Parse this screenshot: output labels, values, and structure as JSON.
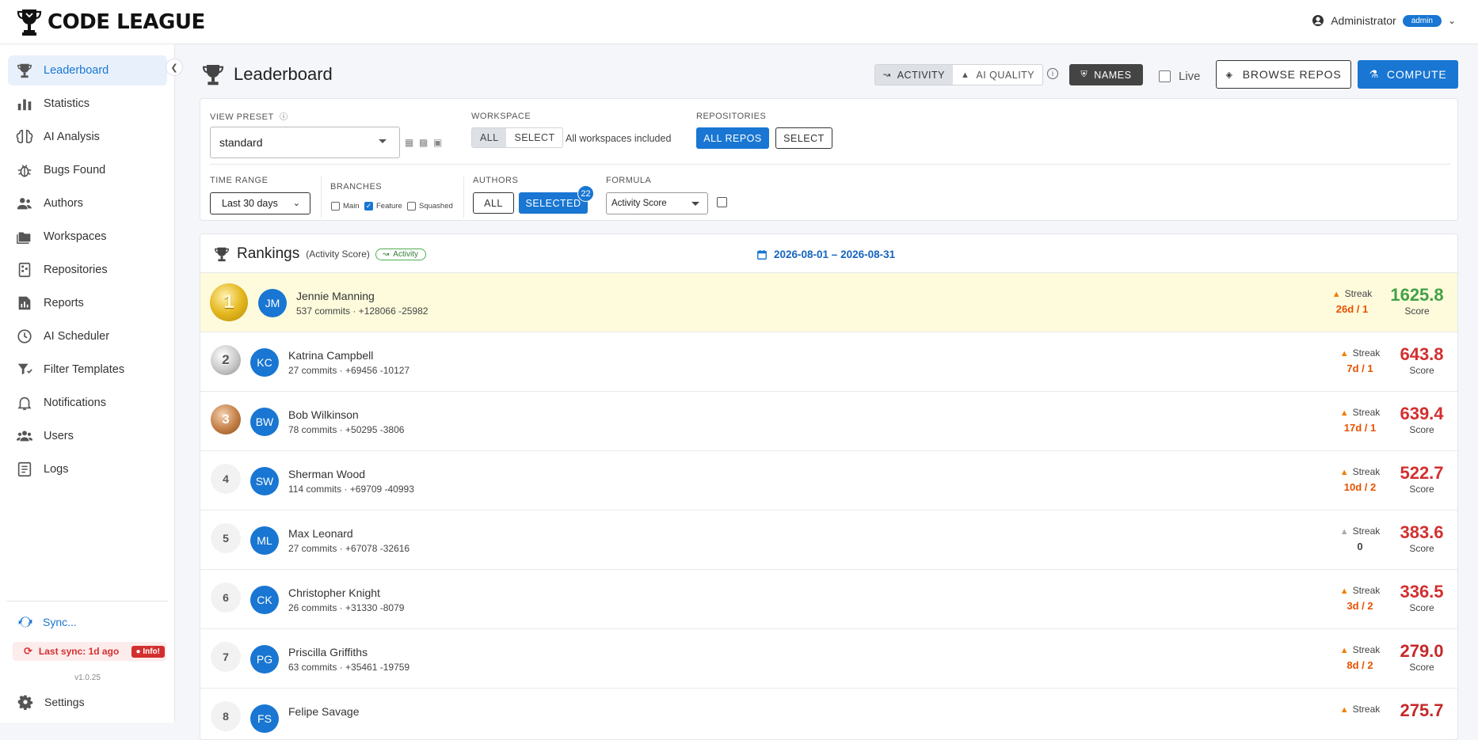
{
  "app": {
    "title": "CODE LEAGUE"
  },
  "user": {
    "name": "Administrator",
    "role": "admin"
  },
  "sidebar": {
    "items": [
      {
        "label": "Leaderboard",
        "icon": "trophy-icon",
        "active": true
      },
      {
        "label": "Statistics",
        "icon": "bar-chart-icon"
      },
      {
        "label": "AI Analysis",
        "icon": "brain-icon"
      },
      {
        "label": "Bugs Found",
        "icon": "bug-icon"
      },
      {
        "label": "Authors",
        "icon": "people-icon"
      },
      {
        "label": "Workspaces",
        "icon": "folders-icon"
      },
      {
        "label": "Repositories",
        "icon": "repo-icon"
      },
      {
        "label": "Reports",
        "icon": "report-icon"
      },
      {
        "label": "AI Scheduler",
        "icon": "clock-icon"
      },
      {
        "label": "Filter Templates",
        "icon": "filter-icon"
      },
      {
        "label": "Notifications",
        "icon": "bell-icon"
      },
      {
        "label": "Users",
        "icon": "users-icon"
      },
      {
        "label": "Logs",
        "icon": "logs-icon"
      }
    ],
    "sync_label": "Sync...",
    "last_sync": "Last sync: 1d ago",
    "info_label": "Info!",
    "version": "v1.0.25",
    "settings_label": "Settings"
  },
  "header": {
    "title": "Leaderboard",
    "mode_activity": "ACTIVITY",
    "mode_ai": "AI QUALITY",
    "names_label": "NAMES",
    "live_label": "Live",
    "browse_label": "BROWSE REPOS",
    "compute_label": "COMPUTE"
  },
  "filters": {
    "view_preset_label": "VIEW PRESET",
    "view_preset_value": "standard",
    "workspace_label": "WORKSPACE",
    "workspace_all": "ALL",
    "workspace_select": "SELECT",
    "workspace_note": "All workspaces included",
    "repositories_label": "REPOSITORIES",
    "repos_all": "ALL REPOS",
    "repos_select": "SELECT",
    "time_range_label": "TIME RANGE",
    "time_range_value": "Last 30 days",
    "branches_label": "BRANCHES",
    "branch_main": "Main",
    "branch_feature": "Feature",
    "branch_squashed": "Squashed",
    "authors_label": "AUTHORS",
    "authors_all": "ALL",
    "authors_selected": "SELECTED",
    "authors_count": "22",
    "formula_label": "FORMULA",
    "formula_value": "Activity Score"
  },
  "rankings": {
    "title": "Rankings",
    "subtitle": "(Activity Score)",
    "tag": "Activity",
    "date_range": "2026-08-01 – 2026-08-31",
    "streak_label": "Streak",
    "score_label": "Score",
    "rows": [
      {
        "rank": "1",
        "initials": "JM",
        "name": "Jennie Manning",
        "stats": "537 commits · +128066 -25982",
        "streak": "26d / 1",
        "score": "1625.8"
      },
      {
        "rank": "2",
        "initials": "KC",
        "name": "Katrina Campbell",
        "stats": "27 commits · +69456 -10127",
        "streak": "7d / 1",
        "score": "643.8"
      },
      {
        "rank": "3",
        "initials": "BW",
        "name": "Bob Wilkinson",
        "stats": "78 commits · +50295 -3806",
        "streak": "17d / 1",
        "score": "639.4"
      },
      {
        "rank": "4",
        "initials": "SW",
        "name": "Sherman Wood",
        "stats": "114 commits · +69709 -40993",
        "streak": "10d / 2",
        "score": "522.7"
      },
      {
        "rank": "5",
        "initials": "ML",
        "name": "Max Leonard",
        "stats": "27 commits · +67078 -32616",
        "streak": "0",
        "score": "383.6"
      },
      {
        "rank": "6",
        "initials": "CK",
        "name": "Christopher Knight",
        "stats": "26 commits · +31330 -8079",
        "streak": "3d / 2",
        "score": "336.5"
      },
      {
        "rank": "7",
        "initials": "PG",
        "name": "Priscilla Griffiths",
        "stats": "63 commits · +35461 -19759",
        "streak": "8d / 2",
        "score": "279.0"
      },
      {
        "rank": "8",
        "initials": "FS",
        "name": "Felipe Savage",
        "stats": "",
        "streak": "",
        "score": "275.7"
      }
    ]
  },
  "colors": {
    "accent": "#1976d2",
    "score_top": "#43a047",
    "score": "#d32f2f",
    "streak": "#e65100"
  }
}
